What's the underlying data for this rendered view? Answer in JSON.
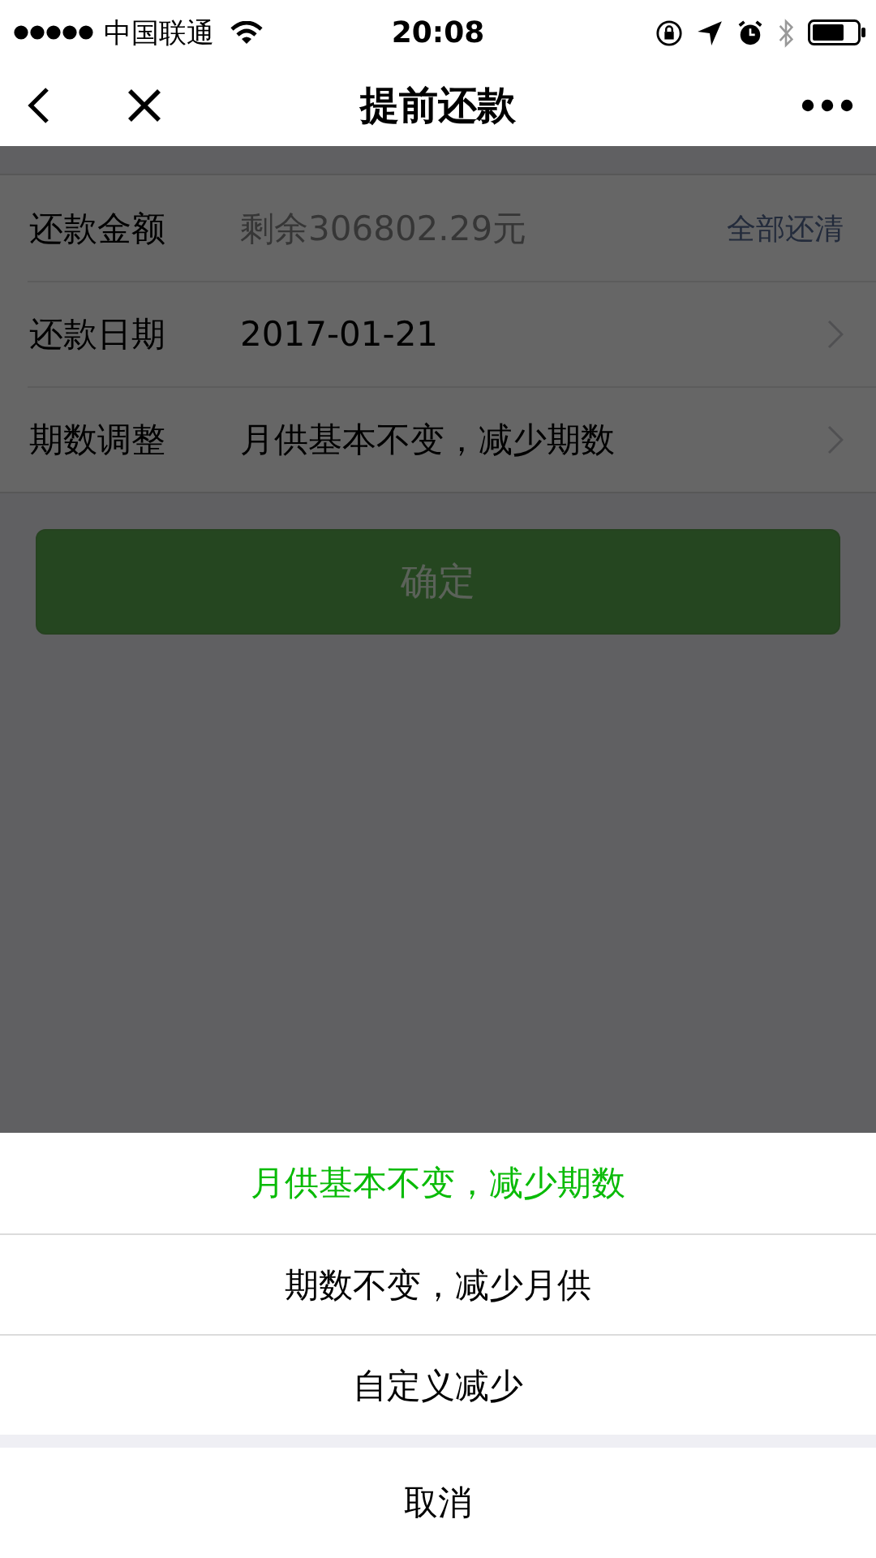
{
  "status_bar": {
    "carrier": "中国联通",
    "time": "20:08"
  },
  "nav": {
    "title": "提前还款"
  },
  "form": {
    "rows": [
      {
        "kind": "input",
        "label": "还款金额",
        "placeholder": "剩余306802.29元",
        "action": "全部还清"
      },
      {
        "kind": "select",
        "label": "还款日期",
        "value": "2017-01-21"
      },
      {
        "kind": "select",
        "label": "期数调整",
        "value": "月供基本不变，减少期数"
      }
    ]
  },
  "confirm_button": {
    "label": "确定",
    "disabled": true
  },
  "action_sheet": {
    "options": [
      {
        "label": "月供基本不变，减少期数",
        "selected": true
      },
      {
        "label": "期数不变，减少月供",
        "selected": false
      },
      {
        "label": "自定义减少",
        "selected": false
      }
    ],
    "cancel": "取消"
  }
}
